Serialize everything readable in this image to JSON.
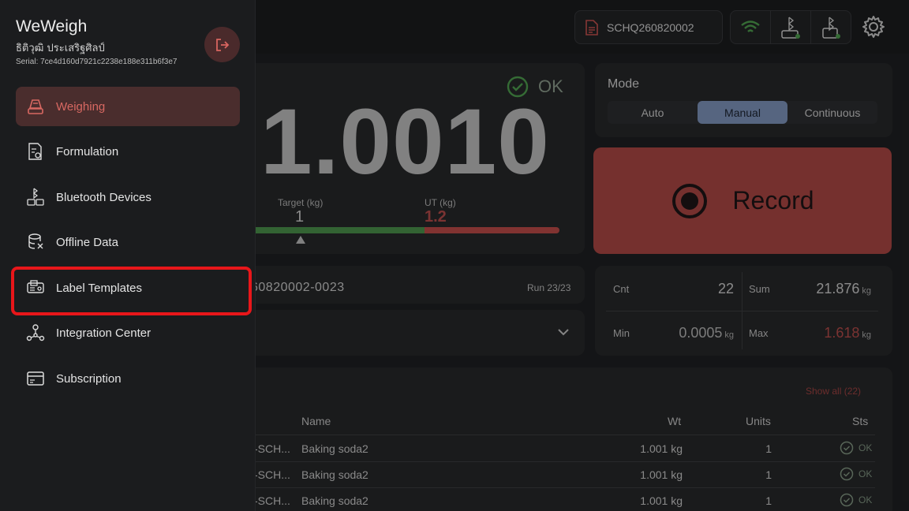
{
  "drawer": {
    "app_title": "WeWeigh",
    "user_name": "ธิติวุฒิ ประเสริฐศิลป์",
    "serial": "Serial: 7ce4d160d7921c2238e188e311b6f3e7",
    "items": [
      {
        "label": "Weighing",
        "icon": "scale-icon",
        "active": true
      },
      {
        "label": "Formulation",
        "icon": "formulation-icon",
        "active": false
      },
      {
        "label": "Bluetooth Devices",
        "icon": "bluetooth-devices-icon",
        "active": false
      },
      {
        "label": "Offline Data",
        "icon": "database-icon",
        "active": false
      },
      {
        "label": "Label Templates",
        "icon": "label-printer-icon",
        "active": false,
        "highlighted": true
      },
      {
        "label": "Integration Center",
        "icon": "integration-icon",
        "active": false
      },
      {
        "label": "Subscription",
        "icon": "card-icon",
        "active": false
      }
    ]
  },
  "topbar": {
    "doc_number": "SCHQ260820002"
  },
  "weight": {
    "status": "OK",
    "value": "1.0010",
    "target_label": "Target (kg)",
    "target_value": "1",
    "ut_label": "UT (kg)",
    "ut_value": "1.2"
  },
  "mode": {
    "title": "Mode",
    "options": [
      "Auto",
      "Manual",
      "Continuous"
    ],
    "selected": "Manual"
  },
  "record": {
    "label": "Record"
  },
  "batch": {
    "id": "60820002-0023",
    "run": "Run 23/23"
  },
  "stats": {
    "cnt_label": "Cnt",
    "cnt_value": "22",
    "sum_label": "Sum",
    "sum_value": "21.876",
    "sum_unit": "kg",
    "min_label": "Min",
    "min_value": "0.0005",
    "min_unit": "kg",
    "max_label": "Max",
    "max_value": "1.618",
    "max_unit": "kg"
  },
  "table": {
    "show_all": "Show all (22)",
    "headers": {
      "name": "Name",
      "wt": "Wt",
      "units": "Units",
      "sts": "Sts"
    },
    "rows": [
      {
        "id": "-SCH...",
        "name": "Baking soda2",
        "wt": "1.001 kg",
        "units": "1",
        "sts": "OK"
      },
      {
        "id": "-SCH...",
        "name": "Baking soda2",
        "wt": "1.001 kg",
        "units": "1",
        "sts": "OK"
      },
      {
        "id": "-SCH...",
        "name": "Baking soda2",
        "wt": "1.001 kg",
        "units": "1",
        "sts": "OK"
      }
    ]
  },
  "colors": {
    "accent_red": "#a84643",
    "active_nav_text": "#d86862",
    "highlight_box": "#e8161a",
    "mode_active": "#7b91b8",
    "ok_green": "#4a8e4a"
  }
}
